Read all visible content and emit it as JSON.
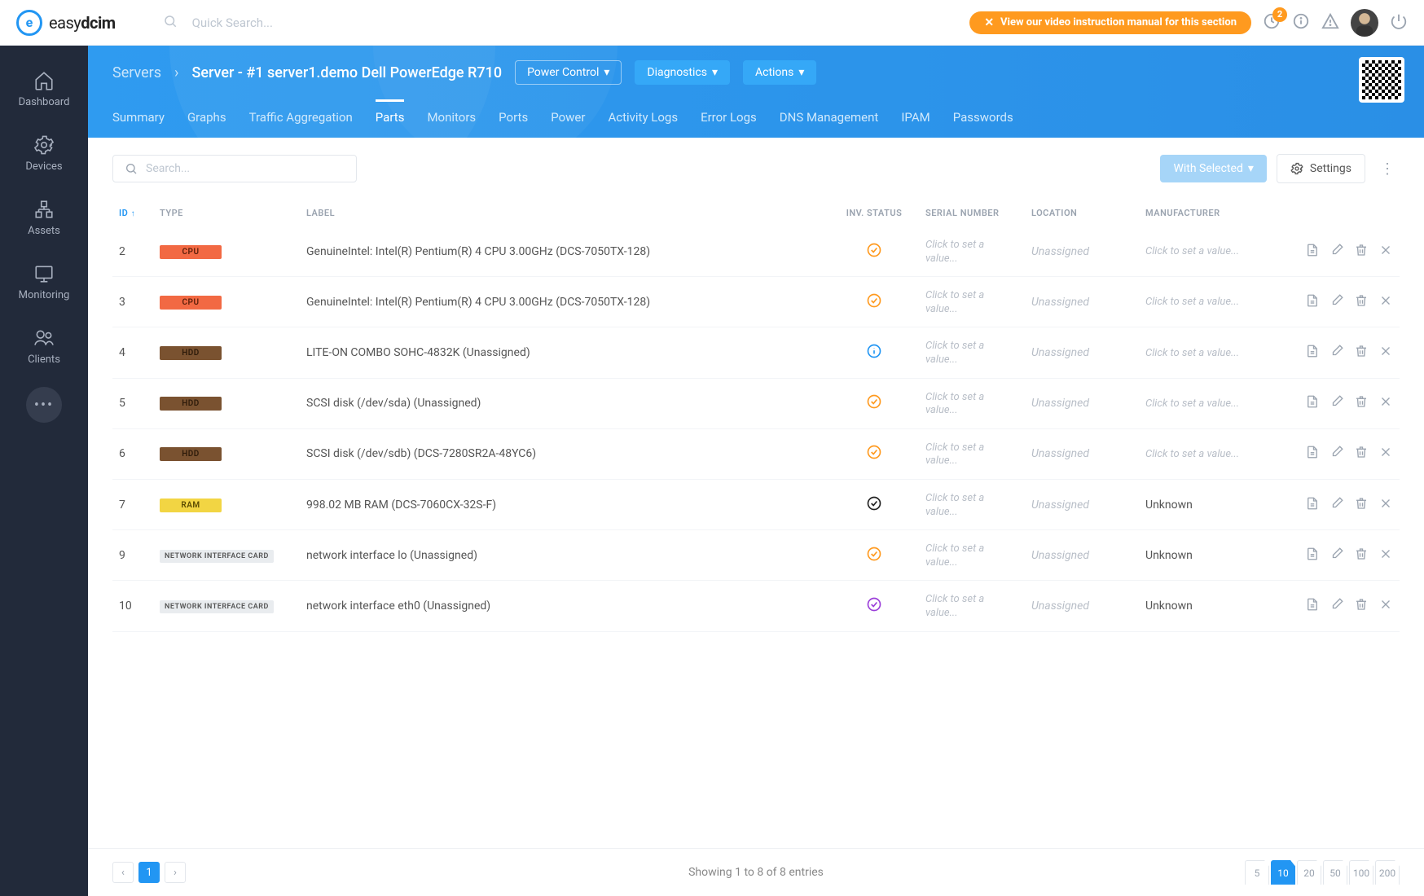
{
  "brand": {
    "name_prefix": "easy",
    "name_bold": "dcim"
  },
  "topbar": {
    "search_placeholder": "Quick Search...",
    "video_banner": "View our video instruction manual for this section",
    "notification_count": "2"
  },
  "sidebar": {
    "items": [
      {
        "label": "Dashboard"
      },
      {
        "label": "Devices"
      },
      {
        "label": "Assets"
      },
      {
        "label": "Monitoring"
      },
      {
        "label": "Clients"
      }
    ]
  },
  "header": {
    "breadcrumb_root": "Servers",
    "breadcrumb_current": "Server - #1 server1.demo Dell PowerEdge R710",
    "power_btn": "Power Control",
    "diag_btn": "Diagnostics",
    "actions_btn": "Actions"
  },
  "tabs": [
    "Summary",
    "Graphs",
    "Traffic Aggregation",
    "Parts",
    "Monitors",
    "Ports",
    "Power",
    "Activity Logs",
    "Error Logs",
    "DNS Management",
    "IPAM",
    "Passwords"
  ],
  "active_tab": "Parts",
  "toolbar": {
    "search_placeholder": "Search...",
    "with_selected": "With Selected",
    "settings": "Settings"
  },
  "columns": {
    "id": "ID",
    "type": "TYPE",
    "label": "LABEL",
    "inv_status": "INV. STATUS",
    "serial": "SERIAL NUMBER",
    "location": "LOCATION",
    "manufacturer": "MANUFACTURER"
  },
  "placeholder_text": "Click to set a value...",
  "unassigned_text": "Unassigned",
  "rows": [
    {
      "id": "2",
      "type": "CPU",
      "type_class": "cpu",
      "label": "GenuineIntel: Intel(R) Pentium(R) 4 CPU 3.00GHz (DCS-7050TX-128)",
      "status": "check-orange",
      "manufacturer": ""
    },
    {
      "id": "3",
      "type": "CPU",
      "type_class": "cpu",
      "label": "GenuineIntel: Intel(R) Pentium(R) 4 CPU 3.00GHz (DCS-7050TX-128)",
      "status": "check-orange",
      "manufacturer": ""
    },
    {
      "id": "4",
      "type": "HDD",
      "type_class": "hdd",
      "label": "LITE-ON COMBO SOHC-4832K (Unassigned)",
      "status": "info-blue",
      "manufacturer": ""
    },
    {
      "id": "5",
      "type": "HDD",
      "type_class": "hdd",
      "label": "SCSI disk (/dev/sda) (Unassigned)",
      "status": "check-orange",
      "manufacturer": ""
    },
    {
      "id": "6",
      "type": "HDD",
      "type_class": "hdd",
      "label": "SCSI disk (/dev/sdb) (DCS-7280SR2A-48YC6)",
      "status": "check-orange",
      "manufacturer": ""
    },
    {
      "id": "7",
      "type": "RAM",
      "type_class": "ram",
      "label": "998.02 MB RAM (DCS-7060CX-32S-F)",
      "status": "check-black",
      "manufacturer": "Unknown"
    },
    {
      "id": "9",
      "type": "NETWORK INTERFACE CARD",
      "type_class": "nic",
      "label": "network interface lo (Unassigned)",
      "status": "check-orange",
      "manufacturer": "Unknown"
    },
    {
      "id": "10",
      "type": "NETWORK INTERFACE CARD",
      "type_class": "nic",
      "label": "network interface eth0 (Unassigned)",
      "status": "check-purple",
      "manufacturer": "Unknown"
    }
  ],
  "footer": {
    "showing": "Showing 1 to 8 of 8 entries",
    "page": "1",
    "sizes": [
      "5",
      "10",
      "20",
      "50",
      "100",
      "200"
    ],
    "active_size": "10"
  }
}
